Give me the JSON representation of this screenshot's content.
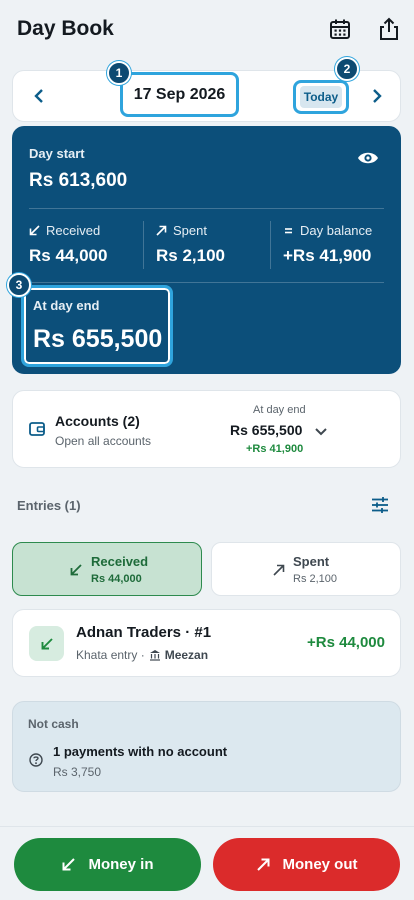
{
  "header": {
    "title": "Day Book",
    "calendar_icon": "calendar-icon",
    "share_icon": "share-icon"
  },
  "datebar": {
    "date": "17 Sep 2026",
    "today_label": "Today",
    "prev_icon": "chevron-left-icon",
    "next_icon": "chevron-right-icon"
  },
  "badges": [
    "1",
    "2",
    "3"
  ],
  "summary": {
    "day_start_label": "Day start",
    "day_start_value": "Rs 613,600",
    "received_label": "Received",
    "received_value": "Rs 44,000",
    "spent_label": "Spent",
    "spent_value": "Rs 2,100",
    "balance_label": "Day balance",
    "balance_value": "+Rs 41,900",
    "day_end_label": "At day end",
    "day_end_value": "Rs 655,500"
  },
  "accounts": {
    "title": "Accounts (2)",
    "subtitle": "Open all accounts",
    "right_label": "At day end",
    "right_value": "Rs 655,500",
    "right_diff": "+Rs 41,900"
  },
  "entries": {
    "header": "Entries (1)",
    "tabs": [
      {
        "label": "Received",
        "amount": "Rs 44,000",
        "selected": true
      },
      {
        "label": "Spent",
        "amount": "Rs 2,100",
        "selected": false
      }
    ],
    "items": [
      {
        "name": "Adnan Traders · #1",
        "type": "Khata entry · ",
        "bank": "Meezan",
        "amount": "+Rs 44,000"
      }
    ]
  },
  "not_cash": {
    "title": "Not cash",
    "main": "1 payments with no account",
    "sub": "Rs 3,750"
  },
  "footer": {
    "money_in": "Money in",
    "money_out": "Money out"
  },
  "colors": {
    "primary": "#0c4f7a",
    "accent": "#2fa4dd",
    "green": "#1e8a3e",
    "red": "#db2b2b"
  }
}
